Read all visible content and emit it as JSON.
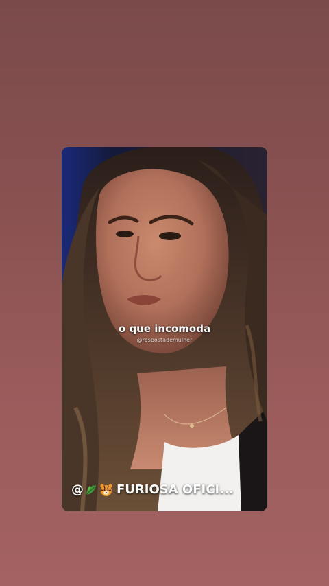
{
  "story": {
    "caption": "o que incomoda",
    "watermark": "@respostademulher",
    "mention": {
      "at_symbol": "@",
      "emojis": [
        "leaves-icon",
        "tiger-icon"
      ],
      "name": "FURIOSA OFICI..."
    }
  },
  "colors": {
    "background_top": "#7a4a4a",
    "background_bottom": "#a46262",
    "caption_text": "#ffffff"
  }
}
